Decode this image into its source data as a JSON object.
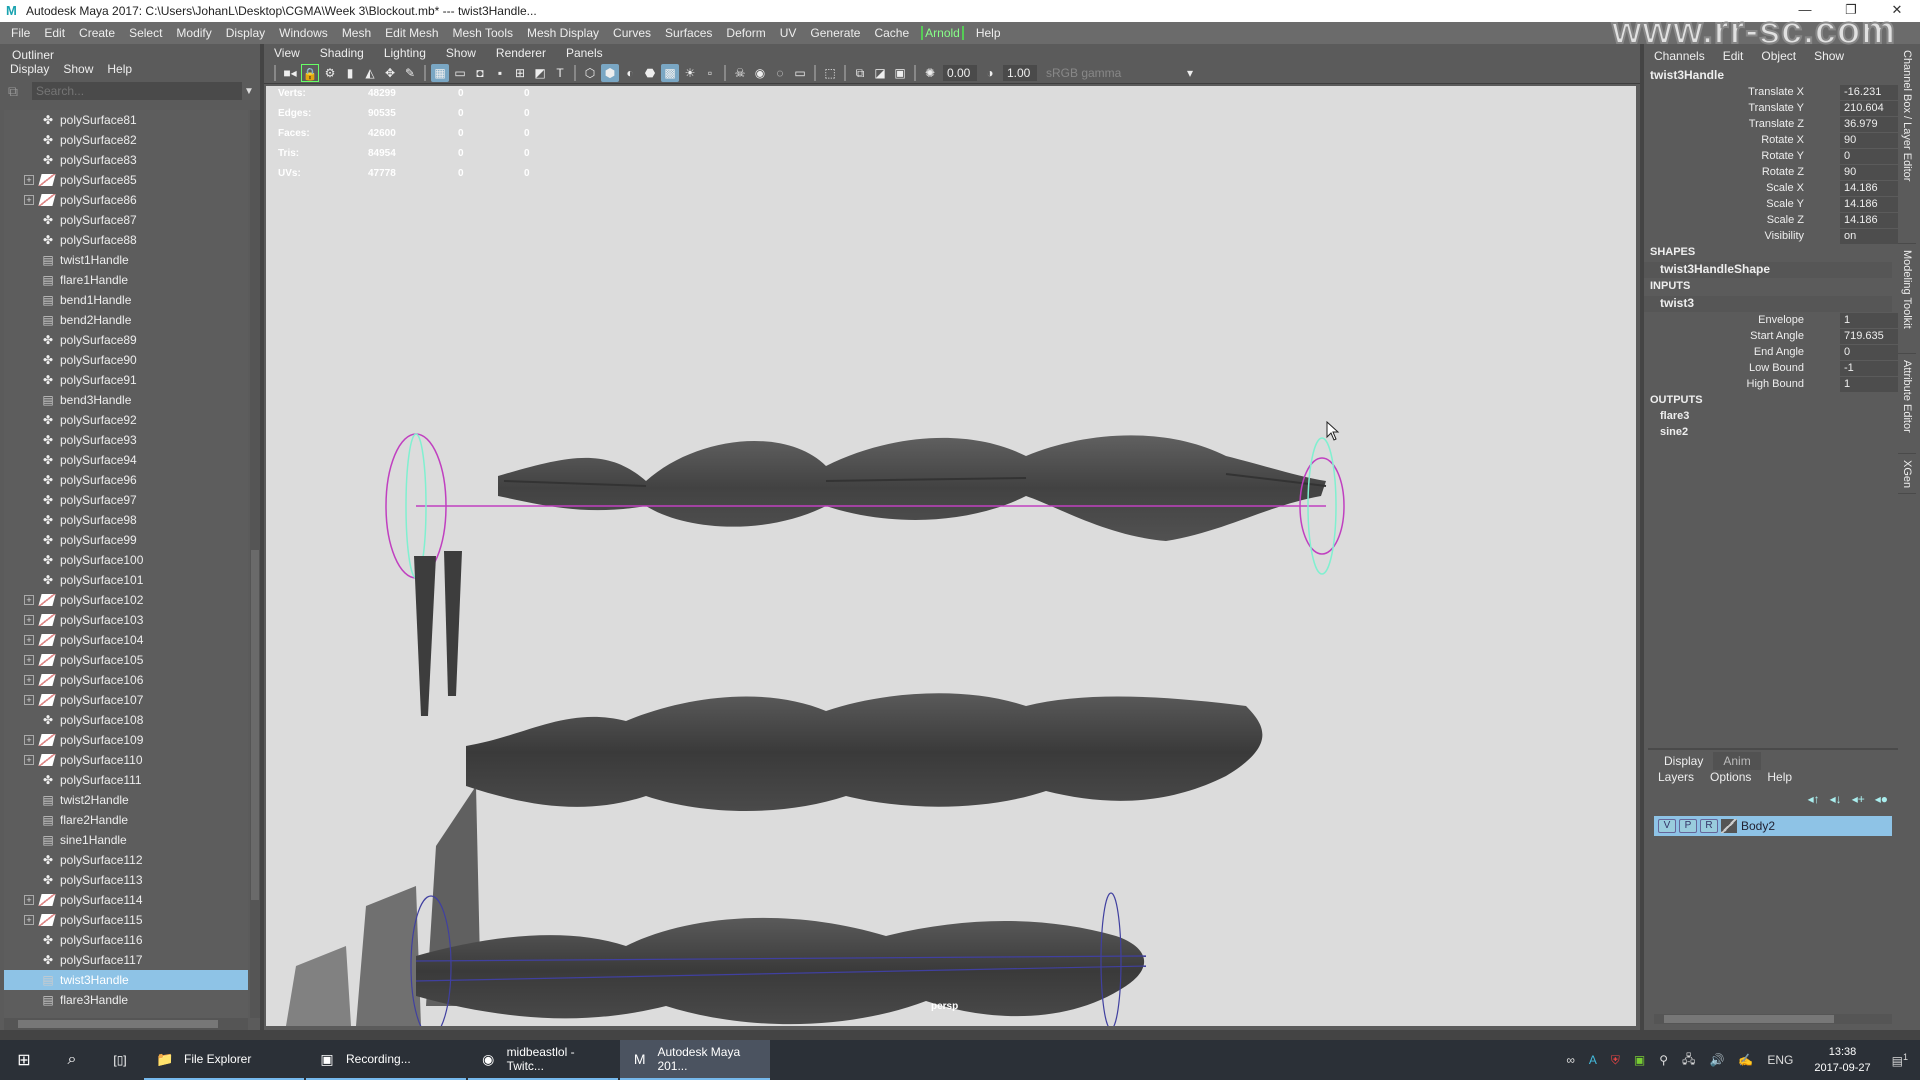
{
  "window": {
    "title": "Autodesk Maya 2017: C:\\Users\\JohanL\\Desktop\\CGMA\\Week 3\\Blockout.mb*  ---  twist3Handle...",
    "controls": [
      "—",
      "❐",
      "✕"
    ]
  },
  "menubar": [
    "File",
    "Edit",
    "Create",
    "Select",
    "Modify",
    "Display",
    "Windows",
    "Mesh",
    "Edit Mesh",
    "Mesh Tools",
    "Mesh Display",
    "Curves",
    "Surfaces",
    "Deform",
    "UV",
    "Generate",
    "Cache",
    "Arnold",
    "Help"
  ],
  "outliner": {
    "title": "Outliner",
    "menus": [
      "Display",
      "Show",
      "Help"
    ],
    "search_placeholder": "Search...",
    "items": [
      {
        "label": "polySurface81",
        "icon": "poly",
        "expand": false
      },
      {
        "label": "polySurface82",
        "icon": "poly",
        "expand": false
      },
      {
        "label": "polySurface83",
        "icon": "poly",
        "expand": false
      },
      {
        "label": "polySurface85",
        "icon": "group",
        "expand": true
      },
      {
        "label": "polySurface86",
        "icon": "group",
        "expand": true
      },
      {
        "label": "polySurface87",
        "icon": "poly",
        "expand": false
      },
      {
        "label": "polySurface88",
        "icon": "poly",
        "expand": false
      },
      {
        "label": "twist1Handle",
        "icon": "handle",
        "expand": false
      },
      {
        "label": "flare1Handle",
        "icon": "handle",
        "expand": false
      },
      {
        "label": "bend1Handle",
        "icon": "handle",
        "expand": false
      },
      {
        "label": "bend2Handle",
        "icon": "handle",
        "expand": false
      },
      {
        "label": "polySurface89",
        "icon": "poly",
        "expand": false
      },
      {
        "label": "polySurface90",
        "icon": "poly",
        "expand": false
      },
      {
        "label": "polySurface91",
        "icon": "poly",
        "expand": false
      },
      {
        "label": "bend3Handle",
        "icon": "handle",
        "expand": false
      },
      {
        "label": "polySurface92",
        "icon": "poly",
        "expand": false
      },
      {
        "label": "polySurface93",
        "icon": "poly",
        "expand": false
      },
      {
        "label": "polySurface94",
        "icon": "poly",
        "expand": false
      },
      {
        "label": "polySurface96",
        "icon": "poly",
        "expand": false
      },
      {
        "label": "polySurface97",
        "icon": "poly",
        "expand": false
      },
      {
        "label": "polySurface98",
        "icon": "poly",
        "expand": false
      },
      {
        "label": "polySurface99",
        "icon": "poly",
        "expand": false
      },
      {
        "label": "polySurface100",
        "icon": "poly",
        "expand": false
      },
      {
        "label": "polySurface101",
        "icon": "poly",
        "expand": false
      },
      {
        "label": "polySurface102",
        "icon": "group",
        "expand": true
      },
      {
        "label": "polySurface103",
        "icon": "group",
        "expand": true
      },
      {
        "label": "polySurface104",
        "icon": "group",
        "expand": true
      },
      {
        "label": "polySurface105",
        "icon": "group",
        "expand": true
      },
      {
        "label": "polySurface106",
        "icon": "group",
        "expand": true
      },
      {
        "label": "polySurface107",
        "icon": "group",
        "expand": true
      },
      {
        "label": "polySurface108",
        "icon": "poly",
        "expand": false
      },
      {
        "label": "polySurface109",
        "icon": "group",
        "expand": true
      },
      {
        "label": "polySurface110",
        "icon": "group",
        "expand": true
      },
      {
        "label": "polySurface111",
        "icon": "poly",
        "expand": false
      },
      {
        "label": "twist2Handle",
        "icon": "handle",
        "expand": false
      },
      {
        "label": "flare2Handle",
        "icon": "handle",
        "expand": false
      },
      {
        "label": "sine1Handle",
        "icon": "handle",
        "expand": false
      },
      {
        "label": "polySurface112",
        "icon": "poly",
        "expand": false
      },
      {
        "label": "polySurface113",
        "icon": "poly",
        "expand": false
      },
      {
        "label": "polySurface114",
        "icon": "group",
        "expand": true
      },
      {
        "label": "polySurface115",
        "icon": "group",
        "expand": true
      },
      {
        "label": "polySurface116",
        "icon": "poly",
        "expand": false
      },
      {
        "label": "polySurface117",
        "icon": "poly",
        "expand": false
      },
      {
        "label": "twist3Handle",
        "icon": "handle",
        "expand": false,
        "selected": true
      },
      {
        "label": "flare3Handle",
        "icon": "handle",
        "expand": false
      }
    ]
  },
  "viewport": {
    "menus": [
      "View",
      "Shading",
      "Lighting",
      "Show",
      "Renderer",
      "Panels"
    ],
    "exposure": "0.00",
    "gamma": "1.00",
    "color_space": "sRGB gamma",
    "camera": "persp",
    "hud": [
      {
        "label": "Verts:",
        "value": "48299",
        "a": "0",
        "b": "0"
      },
      {
        "label": "Edges:",
        "value": "90535",
        "a": "0",
        "b": "0"
      },
      {
        "label": "Faces:",
        "value": "42600",
        "a": "0",
        "b": "0"
      },
      {
        "label": "Tris:",
        "value": "84954",
        "a": "0",
        "b": "0"
      },
      {
        "label": "UVs:",
        "value": "47778",
        "a": "0",
        "b": "0"
      }
    ]
  },
  "channelbox": {
    "menus": [
      "Channels",
      "Edit",
      "Object",
      "Show"
    ],
    "object": "twist3Handle",
    "attributes": [
      {
        "name": "Translate X",
        "value": "-16.231"
      },
      {
        "name": "Translate Y",
        "value": "210.604"
      },
      {
        "name": "Translate Z",
        "value": "36.979"
      },
      {
        "name": "Rotate X",
        "value": "90"
      },
      {
        "name": "Rotate Y",
        "value": "0"
      },
      {
        "name": "Rotate Z",
        "value": "90"
      },
      {
        "name": "Scale X",
        "value": "14.186"
      },
      {
        "name": "Scale Y",
        "value": "14.186"
      },
      {
        "name": "Scale Z",
        "value": "14.186"
      },
      {
        "name": "Visibility",
        "value": "on"
      }
    ],
    "shapes_label": "SHAPES",
    "shape": "twist3HandleShape",
    "inputs_label": "INPUTS",
    "input": "twist3",
    "input_attributes": [
      {
        "name": "Envelope",
        "value": "1"
      },
      {
        "name": "Start Angle",
        "value": "719.635"
      },
      {
        "name": "End Angle",
        "value": "0"
      },
      {
        "name": "Low Bound",
        "value": "-1"
      },
      {
        "name": "High Bound",
        "value": "1"
      }
    ],
    "outputs_label": "OUTPUTS",
    "outputs": [
      "flare3",
      "sine2"
    ]
  },
  "side_tabs": [
    "Channel Box / Layer Editor",
    "Modeling Toolkit",
    "Attribute Editor",
    "XGen"
  ],
  "layer_editor": {
    "tabs": [
      "Display",
      "Anim"
    ],
    "menus": [
      "Layers",
      "Options",
      "Help"
    ],
    "layer": {
      "v": "V",
      "p": "P",
      "r": "R",
      "name": "Body2"
    }
  },
  "taskbar": {
    "apps": [
      {
        "label": "File Explorer",
        "icon": "📁"
      },
      {
        "label": "Recording...",
        "icon": "▣"
      },
      {
        "label": "midbeastlol - Twitc...",
        "icon": "◉"
      },
      {
        "label": "Autodesk Maya 201...",
        "icon": "M"
      }
    ],
    "language": "ENG",
    "time": "13:38",
    "date": "2017-09-27",
    "notifications": "1"
  },
  "watermark": "www.rr-sc.com",
  "colors": {
    "selection": "#8ec3e6",
    "arnold": "#88ff88",
    "deformer_magenta": "#c040c0",
    "deformer_cyan": "#80f0d0",
    "deformer_blue": "#4040a0"
  }
}
